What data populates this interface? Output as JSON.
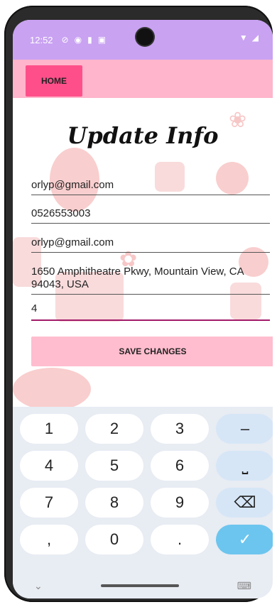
{
  "status_bar": {
    "time": "12:52",
    "left_icons": [
      "vpn-icon",
      "security-icon",
      "sd-card-icon",
      "notification-icon"
    ],
    "right_icons": [
      "wifi-icon",
      "signal-icon"
    ]
  },
  "app_bar": {
    "home_label": "HOME"
  },
  "page": {
    "title": "Update Info"
  },
  "form": {
    "fields": [
      {
        "value": "orlyp@gmail.com"
      },
      {
        "value": "0526553003"
      },
      {
        "value": "orlyp@gmail.com"
      },
      {
        "value": "1650 Amphitheatre Pkwy, Mountain View, CA 94043, USA"
      },
      {
        "value": "4"
      }
    ],
    "save_label": "SAVE CHANGES"
  },
  "keyboard": {
    "rows": [
      [
        "1",
        "2",
        "3",
        "–"
      ],
      [
        "4",
        "5",
        "6",
        "⎵"
      ],
      [
        "7",
        "8",
        "9",
        "⌫"
      ],
      [
        ",",
        "0",
        ".",
        "✓"
      ]
    ]
  },
  "nav": {
    "back_icon": "chevron-down-icon",
    "keyboard_icon": "keyboard-icon"
  },
  "colors": {
    "status_bar": "#c9a2f2",
    "app_bar": "#ffb5cc",
    "home_button": "#ff4f8a",
    "save_button": "#ffbdcf",
    "enter_key": "#6cc5ee"
  }
}
